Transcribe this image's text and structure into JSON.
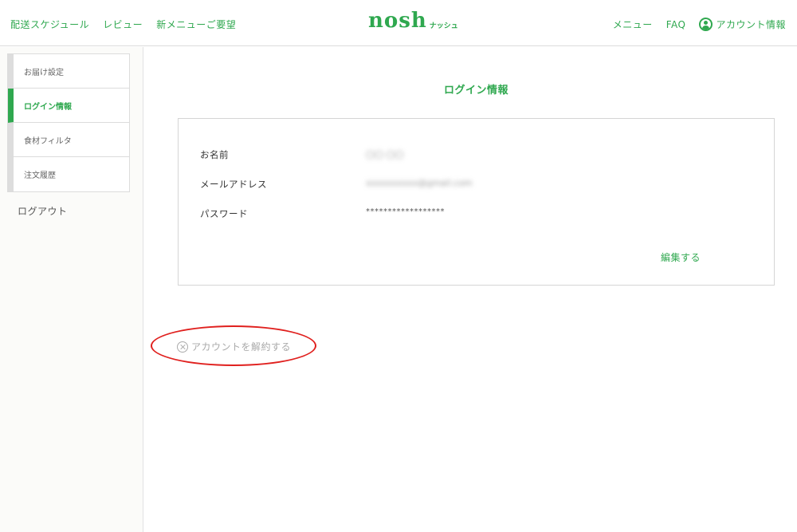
{
  "header": {
    "nav_left": [
      "配送スケジュール",
      "レビュー",
      "新メニューご要望"
    ],
    "logo_main": "nosh",
    "logo_sub": "ナッシュ",
    "nav_right": [
      "メニュー",
      "FAQ"
    ],
    "account_label": "アカウント情報"
  },
  "sidebar": {
    "items": [
      {
        "label": "お届け設定",
        "active": false
      },
      {
        "label": "ログイン情報",
        "active": true
      },
      {
        "label": "食材フィルタ",
        "active": false
      },
      {
        "label": "注文履歴",
        "active": false
      }
    ],
    "logout_label": "ログアウト"
  },
  "main": {
    "title": "ログイン情報",
    "rows": [
      {
        "label": "お名前",
        "value": "〇〇 〇〇"
      },
      {
        "label": "メールアドレス",
        "value": "xxxxxxxxxx@gmail.com"
      },
      {
        "label": "パスワード",
        "value": "******************"
      }
    ],
    "edit_label": "編集する",
    "cancel_label": "アカウントを解約する"
  },
  "colors": {
    "accent": "#2fa84f",
    "highlight": "#e0201e"
  }
}
